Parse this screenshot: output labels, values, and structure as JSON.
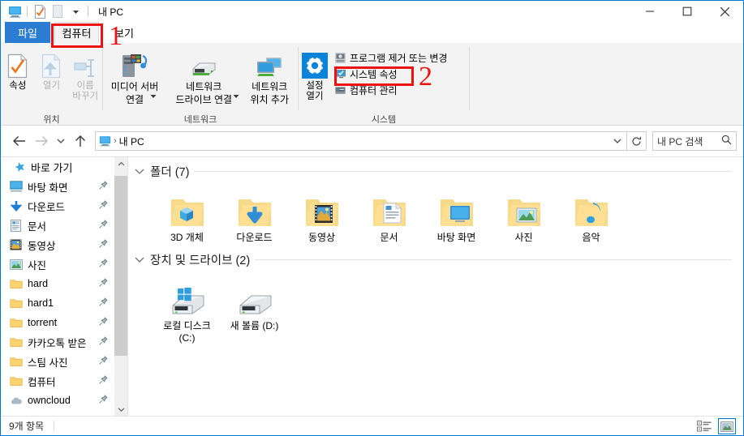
{
  "window": {
    "title": "내 PC",
    "quick_access": [
      "this-pc-icon",
      "properties-icon",
      "new-folder-icon",
      "customize-dropdown-icon"
    ],
    "controls": {
      "minimize": "−",
      "maximize": "□",
      "close": "✕"
    }
  },
  "tabs": [
    {
      "id": "file",
      "label": "파일"
    },
    {
      "id": "computer",
      "label": "컴퓨터"
    },
    {
      "id": "view",
      "label": "보기"
    }
  ],
  "ribbon": {
    "collapse_label": "chevron-up-icon",
    "help_label": "?",
    "groups": [
      {
        "id": "location",
        "label": "위치",
        "buttons": [
          {
            "id": "properties",
            "label": "속성",
            "icon": "properties-icon",
            "enabled": true
          },
          {
            "id": "open",
            "label": "열기",
            "icon": "open-icon",
            "enabled": false
          },
          {
            "id": "rename",
            "label": "이름\n바꾸기",
            "icon": "rename-icon",
            "enabled": false
          }
        ]
      },
      {
        "id": "network",
        "label": "네트워크",
        "buttons": [
          {
            "id": "media-server",
            "label": "미디어 서버\n연결",
            "icon": "media-server-icon",
            "dropdown": true
          },
          {
            "id": "map-drive",
            "label": "네트워크\n드라이브 연결",
            "icon": "map-drive-icon",
            "dropdown": true
          },
          {
            "id": "add-network-location",
            "label": "네트워크\n위치 추가",
            "icon": "add-net-location-icon",
            "dropdown": false
          }
        ]
      },
      {
        "id": "system",
        "label": "시스템",
        "big_button": {
          "id": "open-settings",
          "label": "설정\n열기",
          "icon": "settings-gear-icon"
        },
        "small_items": [
          {
            "id": "uninstall-change-program",
            "label": "프로그램 제거 또는 변경",
            "icon": "uninstall-icon"
          },
          {
            "id": "system-properties",
            "label": "시스템 속성",
            "icon": "system-properties-icon"
          },
          {
            "id": "computer-management",
            "label": "컴퓨터 관리",
            "icon": "computer-management-icon"
          }
        ]
      }
    ]
  },
  "addressbar": {
    "back": "back-arrow-icon",
    "forward": "forward-arrow-icon",
    "recent": "recent-locations-icon",
    "up": "up-arrow-icon",
    "crumb_icon": "this-pc-icon",
    "path": "내 PC",
    "dropdown": "chevron-down-icon",
    "refresh": "refresh-icon",
    "search_placeholder": "내 PC 검색",
    "search_value": "내 PC 검색",
    "search_icon": "search-icon"
  },
  "navpane": {
    "items": [
      {
        "label": "바로 가기",
        "icon": "quick-access-star-icon",
        "root": true,
        "pinned": false
      },
      {
        "label": "바탕 화면",
        "icon": "desktop-icon",
        "root": false,
        "pinned": true
      },
      {
        "label": "다운로드",
        "icon": "downloads-icon",
        "root": false,
        "pinned": true
      },
      {
        "label": "문서",
        "icon": "documents-icon",
        "root": false,
        "pinned": true
      },
      {
        "label": "동영상",
        "icon": "videos-icon",
        "root": false,
        "pinned": true
      },
      {
        "label": "사진",
        "icon": "pictures-icon",
        "root": false,
        "pinned": true
      },
      {
        "label": "hard",
        "icon": "folder-icon",
        "root": false,
        "pinned": true
      },
      {
        "label": "hard1",
        "icon": "folder-icon",
        "root": false,
        "pinned": true
      },
      {
        "label": "torrent",
        "icon": "folder-icon",
        "root": false,
        "pinned": true
      },
      {
        "label": "카카오톡 받은",
        "icon": "folder-icon",
        "root": false,
        "pinned": true
      },
      {
        "label": "스팀 사진",
        "icon": "folder-icon",
        "root": false,
        "pinned": true
      },
      {
        "label": "컴퓨터",
        "icon": "folder-icon",
        "root": false,
        "pinned": true
      },
      {
        "label": "owncloud",
        "icon": "cloud-icon",
        "root": false,
        "pinned": true
      }
    ]
  },
  "content": {
    "groups": [
      {
        "id": "folders",
        "header": "폴더 (7)",
        "items": [
          {
            "label": "3D 개체",
            "icon": "folder-3d-objects-icon"
          },
          {
            "label": "다운로드",
            "icon": "folder-downloads-icon"
          },
          {
            "label": "동영상",
            "icon": "folder-videos-icon"
          },
          {
            "label": "문서",
            "icon": "folder-documents-icon"
          },
          {
            "label": "바탕 화면",
            "icon": "folder-desktop-icon"
          },
          {
            "label": "사진",
            "icon": "folder-pictures-icon"
          },
          {
            "label": "음악",
            "icon": "folder-music-icon"
          }
        ]
      },
      {
        "id": "devices",
        "header": "장치 및 드라이브 (2)",
        "items": [
          {
            "label": "로컬 디스크 (C:)",
            "icon": "system-drive-icon"
          },
          {
            "label": "새 볼륨 (D:)",
            "icon": "drive-icon"
          }
        ]
      }
    ]
  },
  "statusbar": {
    "count_text": "9개 항목",
    "view_details": "details-view-icon",
    "view_large_icons": "large-icons-view-icon"
  },
  "annotations": [
    {
      "id": "step-1",
      "number": "1",
      "target": "컴퓨터"
    },
    {
      "id": "step-2",
      "number": "2",
      "target": "시스템 속성"
    }
  ],
  "colors": {
    "accent": "#0078d7",
    "file_tab": "#2b7cd3",
    "annotation": "#ee1111",
    "folder": "#ffd166"
  }
}
